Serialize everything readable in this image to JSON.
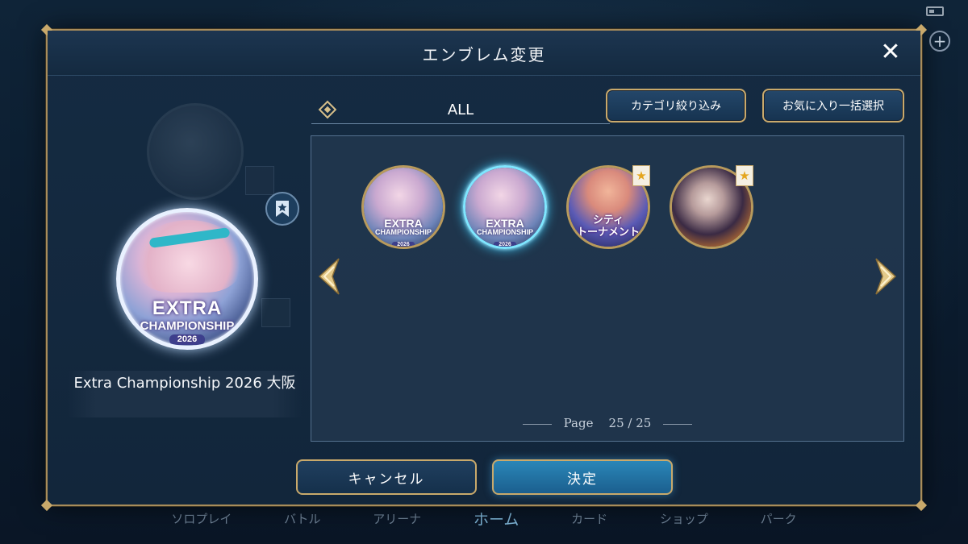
{
  "background": {
    "nav_items": [
      "ソロプレイ",
      "バトル",
      "アリーナ",
      "ホーム",
      "カード",
      "ショップ",
      "パーク"
    ],
    "active_nav": "ホーム"
  },
  "modal": {
    "title": "エンブレム変更",
    "close_icon": "close-icon"
  },
  "preview": {
    "emblem_name": "Extra Championship 2026 大阪",
    "emblem_caption": {
      "line1": "EXTRA",
      "line2": "CHAMPIONSHIP",
      "line3": "2026"
    },
    "favorite_icon": "bookmark-star-icon"
  },
  "filter": {
    "category_label": "ALL",
    "category_filter_button": "カテゴリ絞り込み",
    "bulk_favorite_button": "お気に入り一括選択"
  },
  "emblems": [
    {
      "caption": {
        "line1": "EXTRA",
        "line2": "CHAMPIONSHIP",
        "line3": "2026"
      },
      "selected": false,
      "favorite": false
    },
    {
      "caption": {
        "line1": "EXTRA",
        "line2": "CHAMPIONSHIP",
        "line3": "2026"
      },
      "selected": true,
      "favorite": false
    },
    {
      "caption_jp": "シティ\nトーナメント",
      "selected": false,
      "favorite": true
    },
    {
      "selected": false,
      "favorite": true
    }
  ],
  "pagination": {
    "label": "Page",
    "current": "25",
    "separator": "/",
    "total": "25"
  },
  "footer": {
    "cancel_label": "キャンセル",
    "confirm_label": "決定"
  },
  "colors": {
    "gold_border": "#c9a96b",
    "selected_glow": "#7fe6ff",
    "confirm_button": "#2a86b8"
  }
}
